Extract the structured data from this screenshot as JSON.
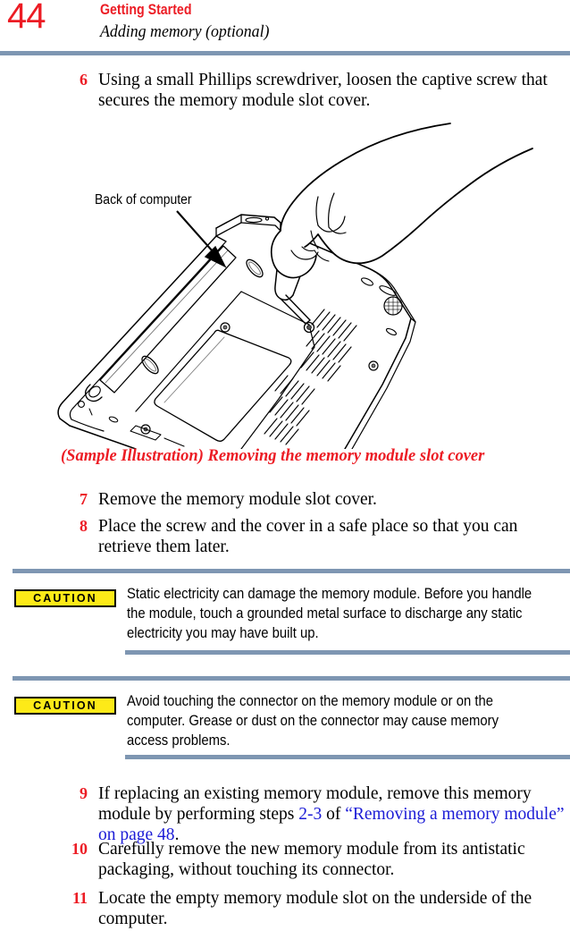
{
  "header": {
    "page_number": "44",
    "chapter": "Getting Started",
    "section": "Adding memory (optional)"
  },
  "steps": [
    {
      "number": "6",
      "text": "Using a small Phillips screwdriver, loosen the captive screw that secures the memory module slot cover."
    },
    {
      "number": "7",
      "text": "Remove the memory module slot cover."
    },
    {
      "number": "8",
      "text": "Place the screw and the cover in a safe place so that you can retrieve them later."
    },
    {
      "number": "9",
      "text_before": "If replacing an existing memory module, remove this memory module by performing steps ",
      "link_1": "2-3",
      "text_middle": " of ",
      "link_2": "“Removing a memory module” on page 48",
      "text_after": "."
    },
    {
      "number": "10",
      "text": "Carefully remove the new memory module from its antistatic packaging, without touching its connector."
    },
    {
      "number": "11",
      "text": "Locate the empty memory module slot on the underside of the computer."
    }
  ],
  "figure": {
    "callout_label": "Back of computer",
    "caption": "(Sample Illustration) Removing the memory module slot cover"
  },
  "cautions": [
    {
      "badge": "CAUTION",
      "text": "Static electricity can damage the memory module. Before you handle the module, touch a grounded metal surface to discharge any static electricity you may have built up."
    },
    {
      "badge": "CAUTION",
      "text": "Avoid touching the connector on the memory module or on the computer. Grease or dust on the connector may cause memory access problems."
    }
  ],
  "colors": {
    "accent_red": "#ec1c24",
    "rule_blue": "#7e96b2",
    "link_blue": "#1b1bd6",
    "caution_yellow": "#fdea18"
  }
}
